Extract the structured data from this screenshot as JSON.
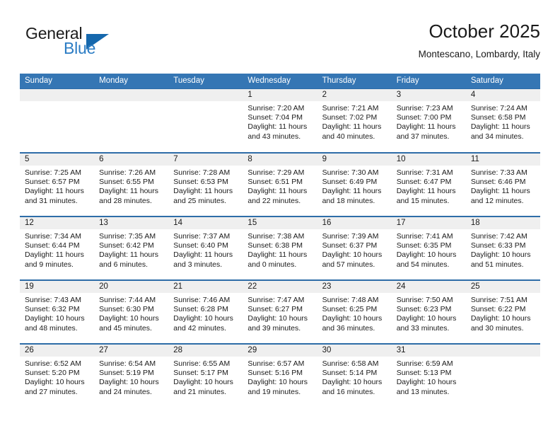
{
  "brand": {
    "name_top": "General",
    "name_bottom": "Blue",
    "triangle_icon": "blue-triangle-logo",
    "color_top": "#1c1c1c",
    "color_bottom": "#2b7cc4",
    "triangle_color": "#1668ad"
  },
  "header": {
    "title": "October 2025",
    "subtitle": "Montescano, Lombardy, Italy"
  },
  "theme": {
    "header_blue": "#3576b4",
    "row_rule_blue": "#2e6da8",
    "day_band_gray": "#efefef",
    "text": "#1a1a1a"
  },
  "weekdays": [
    "Sunday",
    "Monday",
    "Tuesday",
    "Wednesday",
    "Thursday",
    "Friday",
    "Saturday"
  ],
  "weeks": [
    [
      {
        "day": "",
        "lines": []
      },
      {
        "day": "",
        "lines": []
      },
      {
        "day": "",
        "lines": []
      },
      {
        "day": "1",
        "lines": [
          "Sunrise: 7:20 AM",
          "Sunset: 7:04 PM",
          "Daylight: 11 hours",
          "and 43 minutes."
        ]
      },
      {
        "day": "2",
        "lines": [
          "Sunrise: 7:21 AM",
          "Sunset: 7:02 PM",
          "Daylight: 11 hours",
          "and 40 minutes."
        ]
      },
      {
        "day": "3",
        "lines": [
          "Sunrise: 7:23 AM",
          "Sunset: 7:00 PM",
          "Daylight: 11 hours",
          "and 37 minutes."
        ]
      },
      {
        "day": "4",
        "lines": [
          "Sunrise: 7:24 AM",
          "Sunset: 6:58 PM",
          "Daylight: 11 hours",
          "and 34 minutes."
        ]
      }
    ],
    [
      {
        "day": "5",
        "lines": [
          "Sunrise: 7:25 AM",
          "Sunset: 6:57 PM",
          "Daylight: 11 hours",
          "and 31 minutes."
        ]
      },
      {
        "day": "6",
        "lines": [
          "Sunrise: 7:26 AM",
          "Sunset: 6:55 PM",
          "Daylight: 11 hours",
          "and 28 minutes."
        ]
      },
      {
        "day": "7",
        "lines": [
          "Sunrise: 7:28 AM",
          "Sunset: 6:53 PM",
          "Daylight: 11 hours",
          "and 25 minutes."
        ]
      },
      {
        "day": "8",
        "lines": [
          "Sunrise: 7:29 AM",
          "Sunset: 6:51 PM",
          "Daylight: 11 hours",
          "and 22 minutes."
        ]
      },
      {
        "day": "9",
        "lines": [
          "Sunrise: 7:30 AM",
          "Sunset: 6:49 PM",
          "Daylight: 11 hours",
          "and 18 minutes."
        ]
      },
      {
        "day": "10",
        "lines": [
          "Sunrise: 7:31 AM",
          "Sunset: 6:47 PM",
          "Daylight: 11 hours",
          "and 15 minutes."
        ]
      },
      {
        "day": "11",
        "lines": [
          "Sunrise: 7:33 AM",
          "Sunset: 6:46 PM",
          "Daylight: 11 hours",
          "and 12 minutes."
        ]
      }
    ],
    [
      {
        "day": "12",
        "lines": [
          "Sunrise: 7:34 AM",
          "Sunset: 6:44 PM",
          "Daylight: 11 hours",
          "and 9 minutes."
        ]
      },
      {
        "day": "13",
        "lines": [
          "Sunrise: 7:35 AM",
          "Sunset: 6:42 PM",
          "Daylight: 11 hours",
          "and 6 minutes."
        ]
      },
      {
        "day": "14",
        "lines": [
          "Sunrise: 7:37 AM",
          "Sunset: 6:40 PM",
          "Daylight: 11 hours",
          "and 3 minutes."
        ]
      },
      {
        "day": "15",
        "lines": [
          "Sunrise: 7:38 AM",
          "Sunset: 6:38 PM",
          "Daylight: 11 hours",
          "and 0 minutes."
        ]
      },
      {
        "day": "16",
        "lines": [
          "Sunrise: 7:39 AM",
          "Sunset: 6:37 PM",
          "Daylight: 10 hours",
          "and 57 minutes."
        ]
      },
      {
        "day": "17",
        "lines": [
          "Sunrise: 7:41 AM",
          "Sunset: 6:35 PM",
          "Daylight: 10 hours",
          "and 54 minutes."
        ]
      },
      {
        "day": "18",
        "lines": [
          "Sunrise: 7:42 AM",
          "Sunset: 6:33 PM",
          "Daylight: 10 hours",
          "and 51 minutes."
        ]
      }
    ],
    [
      {
        "day": "19",
        "lines": [
          "Sunrise: 7:43 AM",
          "Sunset: 6:32 PM",
          "Daylight: 10 hours",
          "and 48 minutes."
        ]
      },
      {
        "day": "20",
        "lines": [
          "Sunrise: 7:44 AM",
          "Sunset: 6:30 PM",
          "Daylight: 10 hours",
          "and 45 minutes."
        ]
      },
      {
        "day": "21",
        "lines": [
          "Sunrise: 7:46 AM",
          "Sunset: 6:28 PM",
          "Daylight: 10 hours",
          "and 42 minutes."
        ]
      },
      {
        "day": "22",
        "lines": [
          "Sunrise: 7:47 AM",
          "Sunset: 6:27 PM",
          "Daylight: 10 hours",
          "and 39 minutes."
        ]
      },
      {
        "day": "23",
        "lines": [
          "Sunrise: 7:48 AM",
          "Sunset: 6:25 PM",
          "Daylight: 10 hours",
          "and 36 minutes."
        ]
      },
      {
        "day": "24",
        "lines": [
          "Sunrise: 7:50 AM",
          "Sunset: 6:23 PM",
          "Daylight: 10 hours",
          "and 33 minutes."
        ]
      },
      {
        "day": "25",
        "lines": [
          "Sunrise: 7:51 AM",
          "Sunset: 6:22 PM",
          "Daylight: 10 hours",
          "and 30 minutes."
        ]
      }
    ],
    [
      {
        "day": "26",
        "lines": [
          "Sunrise: 6:52 AM",
          "Sunset: 5:20 PM",
          "Daylight: 10 hours",
          "and 27 minutes."
        ]
      },
      {
        "day": "27",
        "lines": [
          "Sunrise: 6:54 AM",
          "Sunset: 5:19 PM",
          "Daylight: 10 hours",
          "and 24 minutes."
        ]
      },
      {
        "day": "28",
        "lines": [
          "Sunrise: 6:55 AM",
          "Sunset: 5:17 PM",
          "Daylight: 10 hours",
          "and 21 minutes."
        ]
      },
      {
        "day": "29",
        "lines": [
          "Sunrise: 6:57 AM",
          "Sunset: 5:16 PM",
          "Daylight: 10 hours",
          "and 19 minutes."
        ]
      },
      {
        "day": "30",
        "lines": [
          "Sunrise: 6:58 AM",
          "Sunset: 5:14 PM",
          "Daylight: 10 hours",
          "and 16 minutes."
        ]
      },
      {
        "day": "31",
        "lines": [
          "Sunrise: 6:59 AM",
          "Sunset: 5:13 PM",
          "Daylight: 10 hours",
          "and 13 minutes."
        ]
      },
      {
        "day": "",
        "lines": []
      }
    ]
  ]
}
